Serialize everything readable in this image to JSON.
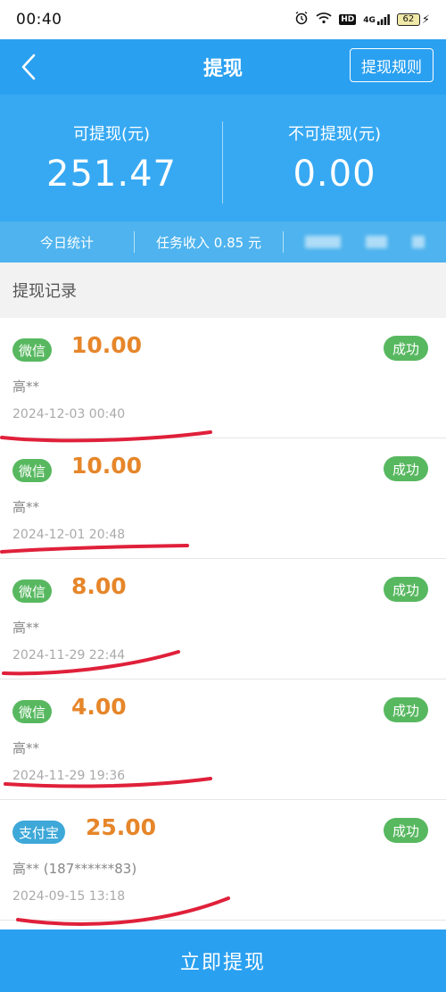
{
  "status_bar": {
    "time": "00:40",
    "network": "4G",
    "hd": "HD",
    "battery": "62"
  },
  "nav": {
    "title": "提现",
    "rules_label": "提现规则"
  },
  "summary": {
    "withdrawable_label": "可提现(元)",
    "withdrawable_value": "251.47",
    "non_withdrawable_label": "不可提现(元)",
    "non_withdrawable_value": "0.00"
  },
  "stats": {
    "today_label": "今日统计",
    "task_income": "任务收入 0.85 元"
  },
  "records_section": {
    "title": "提现记录"
  },
  "records": [
    {
      "method": "微信",
      "method_type": "wechat",
      "amount": "10.00",
      "status": "成功",
      "name": "高**",
      "date": "2024-12-03 00:40"
    },
    {
      "method": "微信",
      "method_type": "wechat",
      "amount": "10.00",
      "status": "成功",
      "name": "高**",
      "date": "2024-12-01 20:48"
    },
    {
      "method": "微信",
      "method_type": "wechat",
      "amount": "8.00",
      "status": "成功",
      "name": "高**",
      "date": "2024-11-29 22:44"
    },
    {
      "method": "微信",
      "method_type": "wechat",
      "amount": "4.00",
      "status": "成功",
      "name": "高**",
      "date": "2024-11-29 19:36"
    },
    {
      "method": "支付宝",
      "method_type": "alipay",
      "amount": "25.00",
      "status": "成功",
      "name": "高** (187******83)",
      "date": "2024-09-15 13:18"
    }
  ],
  "bottom": {
    "withdraw_label": "立即提现"
  },
  "colors": {
    "primary_blue": "#2aa0f0",
    "amount_orange": "#e6862a",
    "success_green": "#58b860",
    "alipay_blue": "#3ea8d8",
    "scribble_red": "#e0203a"
  }
}
